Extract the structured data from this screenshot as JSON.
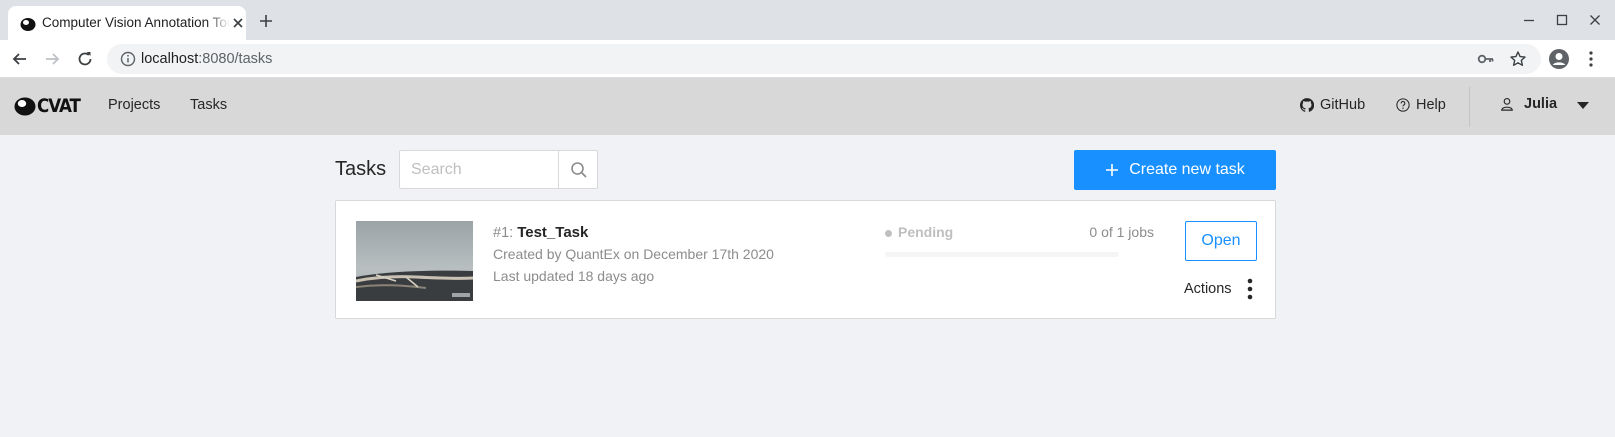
{
  "browser": {
    "tab_title": "Computer Vision Annotation Tool",
    "url_host": "localhost",
    "url_rest": ":8080/tasks"
  },
  "app": {
    "logo_text": "CVAT",
    "nav": [
      {
        "label": "Projects"
      },
      {
        "label": "Tasks"
      }
    ],
    "github_label": "GitHub",
    "help_label": "Help",
    "user_name": "Julia"
  },
  "tasks_page": {
    "title": "Tasks",
    "search_placeholder": "Search",
    "create_label": "Create new task"
  },
  "task": {
    "id_label": "#1:",
    "name": "Test_Task",
    "created": "Created by QuantEx on December 17th 2020",
    "updated": "Last updated 18 days ago",
    "status": "Pending",
    "jobs": "0 of 1 jobs",
    "progress": 0,
    "open_label": "Open",
    "actions_label": "Actions"
  },
  "colors": {
    "accent": "#1890ff",
    "header_bg": "#d8d8d8",
    "page_bg": "#f0f2f5"
  }
}
